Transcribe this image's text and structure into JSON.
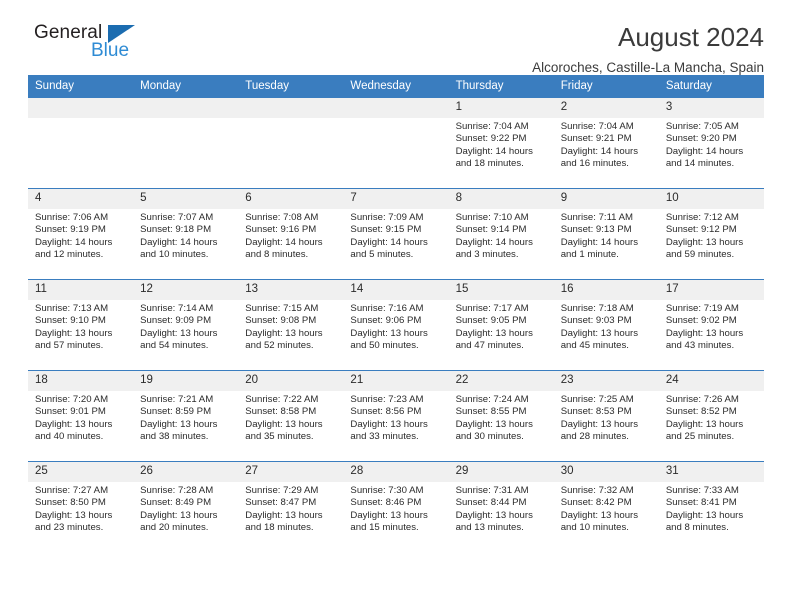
{
  "brand": {
    "name_top": "General",
    "name_bottom": "Blue",
    "triangle_color": "#1b6cb0",
    "blue_color": "#2e8bd4"
  },
  "header": {
    "title": "August 2024",
    "location": "Alcoroches, Castille-La Mancha, Spain"
  },
  "theme": {
    "header_row_bg": "#3a7dbf",
    "daynum_bg": "#f0f0f0",
    "text_color": "#2b2b2b"
  },
  "calendar": {
    "weekday_headers": [
      "Sunday",
      "Monday",
      "Tuesday",
      "Wednesday",
      "Thursday",
      "Friday",
      "Saturday"
    ],
    "weeks": [
      [
        {
          "day": "",
          "empty": true,
          "sunrise": "",
          "sunset": "",
          "daylight_line1": "",
          "daylight_line2": ""
        },
        {
          "day": "",
          "empty": true,
          "sunrise": "",
          "sunset": "",
          "daylight_line1": "",
          "daylight_line2": ""
        },
        {
          "day": "",
          "empty": true,
          "sunrise": "",
          "sunset": "",
          "daylight_line1": "",
          "daylight_line2": ""
        },
        {
          "day": "",
          "empty": true,
          "sunrise": "",
          "sunset": "",
          "daylight_line1": "",
          "daylight_line2": ""
        },
        {
          "day": "1",
          "empty": false,
          "sunrise": "Sunrise: 7:04 AM",
          "sunset": "Sunset: 9:22 PM",
          "daylight_line1": "Daylight: 14 hours",
          "daylight_line2": "and 18 minutes."
        },
        {
          "day": "2",
          "empty": false,
          "sunrise": "Sunrise: 7:04 AM",
          "sunset": "Sunset: 9:21 PM",
          "daylight_line1": "Daylight: 14 hours",
          "daylight_line2": "and 16 minutes."
        },
        {
          "day": "3",
          "empty": false,
          "sunrise": "Sunrise: 7:05 AM",
          "sunset": "Sunset: 9:20 PM",
          "daylight_line1": "Daylight: 14 hours",
          "daylight_line2": "and 14 minutes."
        }
      ],
      [
        {
          "day": "4",
          "empty": false,
          "sunrise": "Sunrise: 7:06 AM",
          "sunset": "Sunset: 9:19 PM",
          "daylight_line1": "Daylight: 14 hours",
          "daylight_line2": "and 12 minutes."
        },
        {
          "day": "5",
          "empty": false,
          "sunrise": "Sunrise: 7:07 AM",
          "sunset": "Sunset: 9:18 PM",
          "daylight_line1": "Daylight: 14 hours",
          "daylight_line2": "and 10 minutes."
        },
        {
          "day": "6",
          "empty": false,
          "sunrise": "Sunrise: 7:08 AM",
          "sunset": "Sunset: 9:16 PM",
          "daylight_line1": "Daylight: 14 hours",
          "daylight_line2": "and 8 minutes."
        },
        {
          "day": "7",
          "empty": false,
          "sunrise": "Sunrise: 7:09 AM",
          "sunset": "Sunset: 9:15 PM",
          "daylight_line1": "Daylight: 14 hours",
          "daylight_line2": "and 5 minutes."
        },
        {
          "day": "8",
          "empty": false,
          "sunrise": "Sunrise: 7:10 AM",
          "sunset": "Sunset: 9:14 PM",
          "daylight_line1": "Daylight: 14 hours",
          "daylight_line2": "and 3 minutes."
        },
        {
          "day": "9",
          "empty": false,
          "sunrise": "Sunrise: 7:11 AM",
          "sunset": "Sunset: 9:13 PM",
          "daylight_line1": "Daylight: 14 hours",
          "daylight_line2": "and 1 minute."
        },
        {
          "day": "10",
          "empty": false,
          "sunrise": "Sunrise: 7:12 AM",
          "sunset": "Sunset: 9:12 PM",
          "daylight_line1": "Daylight: 13 hours",
          "daylight_line2": "and 59 minutes."
        }
      ],
      [
        {
          "day": "11",
          "empty": false,
          "sunrise": "Sunrise: 7:13 AM",
          "sunset": "Sunset: 9:10 PM",
          "daylight_line1": "Daylight: 13 hours",
          "daylight_line2": "and 57 minutes."
        },
        {
          "day": "12",
          "empty": false,
          "sunrise": "Sunrise: 7:14 AM",
          "sunset": "Sunset: 9:09 PM",
          "daylight_line1": "Daylight: 13 hours",
          "daylight_line2": "and 54 minutes."
        },
        {
          "day": "13",
          "empty": false,
          "sunrise": "Sunrise: 7:15 AM",
          "sunset": "Sunset: 9:08 PM",
          "daylight_line1": "Daylight: 13 hours",
          "daylight_line2": "and 52 minutes."
        },
        {
          "day": "14",
          "empty": false,
          "sunrise": "Sunrise: 7:16 AM",
          "sunset": "Sunset: 9:06 PM",
          "daylight_line1": "Daylight: 13 hours",
          "daylight_line2": "and 50 minutes."
        },
        {
          "day": "15",
          "empty": false,
          "sunrise": "Sunrise: 7:17 AM",
          "sunset": "Sunset: 9:05 PM",
          "daylight_line1": "Daylight: 13 hours",
          "daylight_line2": "and 47 minutes."
        },
        {
          "day": "16",
          "empty": false,
          "sunrise": "Sunrise: 7:18 AM",
          "sunset": "Sunset: 9:03 PM",
          "daylight_line1": "Daylight: 13 hours",
          "daylight_line2": "and 45 minutes."
        },
        {
          "day": "17",
          "empty": false,
          "sunrise": "Sunrise: 7:19 AM",
          "sunset": "Sunset: 9:02 PM",
          "daylight_line1": "Daylight: 13 hours",
          "daylight_line2": "and 43 minutes."
        }
      ],
      [
        {
          "day": "18",
          "empty": false,
          "sunrise": "Sunrise: 7:20 AM",
          "sunset": "Sunset: 9:01 PM",
          "daylight_line1": "Daylight: 13 hours",
          "daylight_line2": "and 40 minutes."
        },
        {
          "day": "19",
          "empty": false,
          "sunrise": "Sunrise: 7:21 AM",
          "sunset": "Sunset: 8:59 PM",
          "daylight_line1": "Daylight: 13 hours",
          "daylight_line2": "and 38 minutes."
        },
        {
          "day": "20",
          "empty": false,
          "sunrise": "Sunrise: 7:22 AM",
          "sunset": "Sunset: 8:58 PM",
          "daylight_line1": "Daylight: 13 hours",
          "daylight_line2": "and 35 minutes."
        },
        {
          "day": "21",
          "empty": false,
          "sunrise": "Sunrise: 7:23 AM",
          "sunset": "Sunset: 8:56 PM",
          "daylight_line1": "Daylight: 13 hours",
          "daylight_line2": "and 33 minutes."
        },
        {
          "day": "22",
          "empty": false,
          "sunrise": "Sunrise: 7:24 AM",
          "sunset": "Sunset: 8:55 PM",
          "daylight_line1": "Daylight: 13 hours",
          "daylight_line2": "and 30 minutes."
        },
        {
          "day": "23",
          "empty": false,
          "sunrise": "Sunrise: 7:25 AM",
          "sunset": "Sunset: 8:53 PM",
          "daylight_line1": "Daylight: 13 hours",
          "daylight_line2": "and 28 minutes."
        },
        {
          "day": "24",
          "empty": false,
          "sunrise": "Sunrise: 7:26 AM",
          "sunset": "Sunset: 8:52 PM",
          "daylight_line1": "Daylight: 13 hours",
          "daylight_line2": "and 25 minutes."
        }
      ],
      [
        {
          "day": "25",
          "empty": false,
          "sunrise": "Sunrise: 7:27 AM",
          "sunset": "Sunset: 8:50 PM",
          "daylight_line1": "Daylight: 13 hours",
          "daylight_line2": "and 23 minutes."
        },
        {
          "day": "26",
          "empty": false,
          "sunrise": "Sunrise: 7:28 AM",
          "sunset": "Sunset: 8:49 PM",
          "daylight_line1": "Daylight: 13 hours",
          "daylight_line2": "and 20 minutes."
        },
        {
          "day": "27",
          "empty": false,
          "sunrise": "Sunrise: 7:29 AM",
          "sunset": "Sunset: 8:47 PM",
          "daylight_line1": "Daylight: 13 hours",
          "daylight_line2": "and 18 minutes."
        },
        {
          "day": "28",
          "empty": false,
          "sunrise": "Sunrise: 7:30 AM",
          "sunset": "Sunset: 8:46 PM",
          "daylight_line1": "Daylight: 13 hours",
          "daylight_line2": "and 15 minutes."
        },
        {
          "day": "29",
          "empty": false,
          "sunrise": "Sunrise: 7:31 AM",
          "sunset": "Sunset: 8:44 PM",
          "daylight_line1": "Daylight: 13 hours",
          "daylight_line2": "and 13 minutes."
        },
        {
          "day": "30",
          "empty": false,
          "sunrise": "Sunrise: 7:32 AM",
          "sunset": "Sunset: 8:42 PM",
          "daylight_line1": "Daylight: 13 hours",
          "daylight_line2": "and 10 minutes."
        },
        {
          "day": "31",
          "empty": false,
          "sunrise": "Sunrise: 7:33 AM",
          "sunset": "Sunset: 8:41 PM",
          "daylight_line1": "Daylight: 13 hours",
          "daylight_line2": "and 8 minutes."
        }
      ]
    ]
  }
}
